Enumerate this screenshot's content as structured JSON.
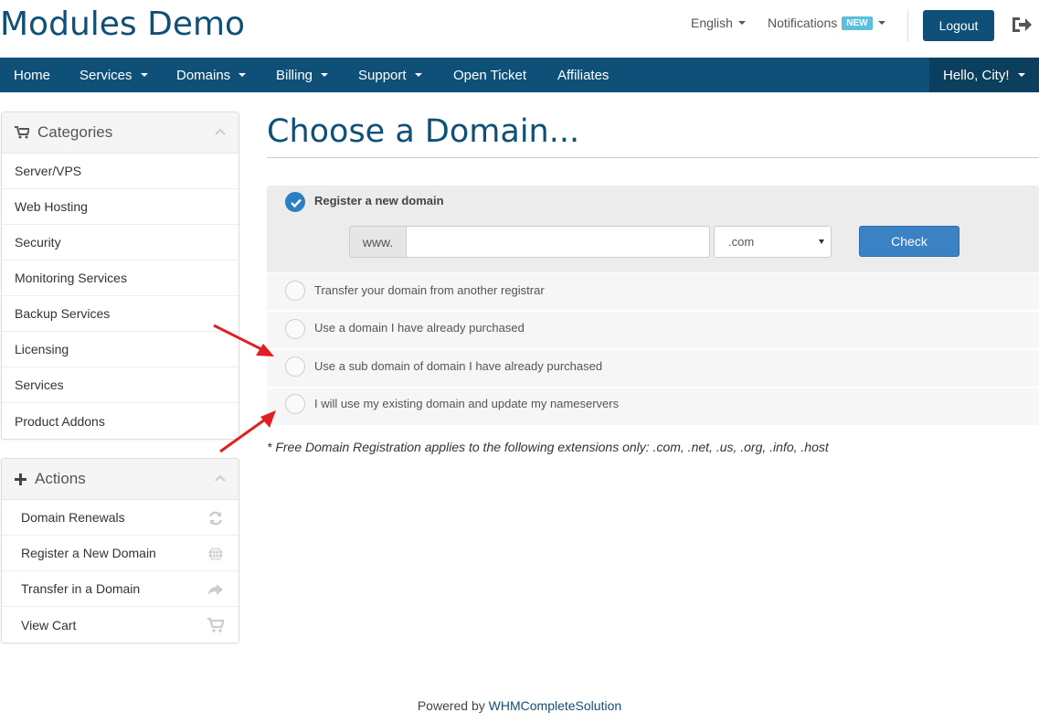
{
  "header": {
    "logo": "Modules Demo",
    "language": "English",
    "notifications": "Notifications",
    "notifications_badge": "NEW",
    "logout": "Logout"
  },
  "nav": {
    "items": [
      "Home",
      "Services",
      "Domains",
      "Billing",
      "Support",
      "Open Ticket",
      "Affiliates"
    ],
    "user": "Hello, City!"
  },
  "sidebar": {
    "categories_title": "Categories",
    "categories": [
      "Server/VPS",
      "Web Hosting",
      "Security",
      "Monitoring Services",
      "Backup Services",
      "Licensing",
      "Services",
      "Product Addons"
    ],
    "actions_title": "Actions",
    "actions": [
      {
        "label": "Domain Renewals",
        "icon": "refresh-icon"
      },
      {
        "label": "Register a New Domain",
        "icon": "globe-icon"
      },
      {
        "label": "Transfer in a Domain",
        "icon": "share-icon"
      },
      {
        "label": "View Cart",
        "icon": "cart-icon"
      }
    ]
  },
  "main": {
    "title": "Choose a Domain...",
    "options": [
      {
        "label": "Register a new domain",
        "selected": true
      },
      {
        "label": "Transfer your domain from another registrar",
        "selected": false
      },
      {
        "label": "Use a domain I have already purchased",
        "selected": false
      },
      {
        "label": "Use a sub domain of domain I have already purchased",
        "selected": false
      },
      {
        "label": "I will use my existing domain and update my nameservers",
        "selected": false
      }
    ],
    "www_prefix": "www.",
    "domain_value": "",
    "tld_selected": ".com",
    "check_button": "Check",
    "note": "* Free Domain Registration applies to the following extensions only: .com, .net, .us, .org, .info, .host"
  },
  "footer": {
    "powered_by": "Powered by",
    "link": "WHMCompleteSolution"
  },
  "colors": {
    "brand": "#0e5077",
    "accent": "#3b82c4",
    "annotation_arrow": "#e02020"
  }
}
